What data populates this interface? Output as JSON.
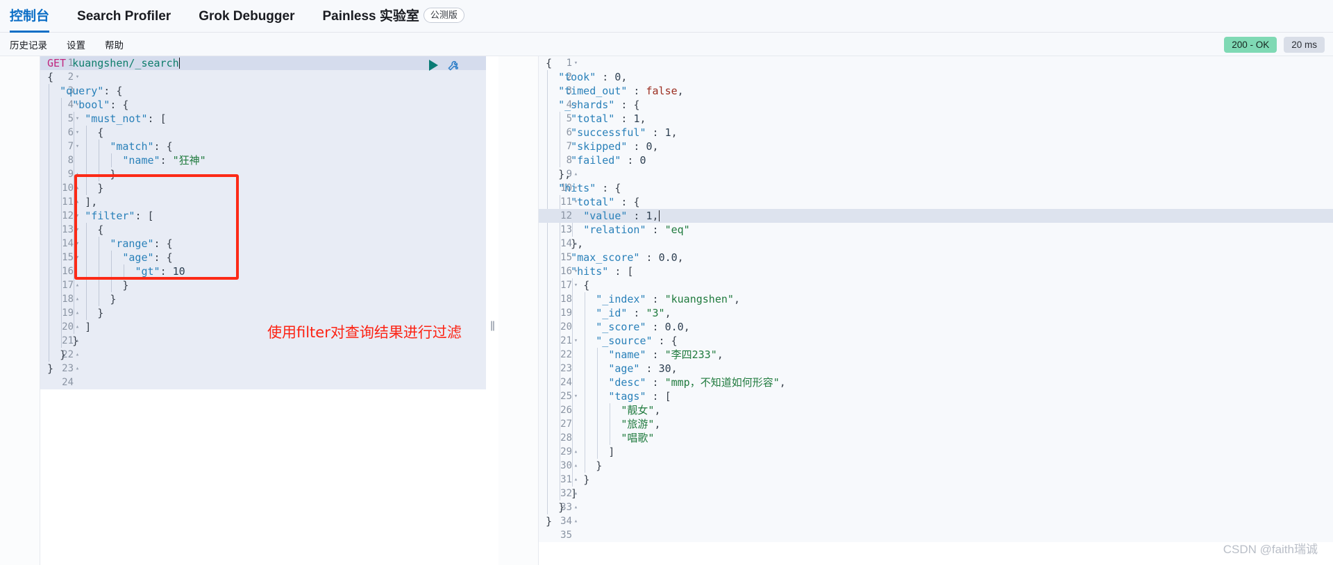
{
  "topnav": {
    "tabs": [
      {
        "label": "控制台",
        "active": true
      },
      {
        "label": "Search Profiler",
        "active": false
      },
      {
        "label": "Grok Debugger",
        "active": false
      },
      {
        "label": "Painless 实验室",
        "active": false,
        "badge": "公测版"
      }
    ]
  },
  "subbar": {
    "items": [
      {
        "label": "历史记录"
      },
      {
        "label": "设置"
      },
      {
        "label": "帮助"
      }
    ],
    "status": "200 - OK",
    "duration": "20 ms",
    "status_color": "#7fd9b4",
    "duration_color": "#d9dee8"
  },
  "icons": {
    "play": "play-icon",
    "wrench": "wrench-icon"
  },
  "request_editor": {
    "total_lines": 24,
    "lines": [
      {
        "n": 1,
        "fold": "",
        "indent": 0,
        "text": "GET kuangshen/_search",
        "type": "request",
        "method": "GET",
        "path": "kuangshen/_search",
        "caret": true,
        "highlight": true
      },
      {
        "n": 2,
        "fold": "▾",
        "indent": 0,
        "text": "{"
      },
      {
        "n": 3,
        "fold": "▾",
        "indent": 1,
        "text": "\"query\": {"
      },
      {
        "n": 4,
        "fold": "▾",
        "indent": 2,
        "text": "\"bool\": {"
      },
      {
        "n": 5,
        "fold": "▾",
        "indent": 3,
        "text": "\"must_not\": ["
      },
      {
        "n": 6,
        "fold": "▾",
        "indent": 4,
        "text": "{"
      },
      {
        "n": 7,
        "fold": "▾",
        "indent": 5,
        "text": "\"match\": {"
      },
      {
        "n": 8,
        "fold": "",
        "indent": 6,
        "text": "\"name\": \"狂神\""
      },
      {
        "n": 9,
        "fold": "▴",
        "indent": 5,
        "text": "}"
      },
      {
        "n": 10,
        "fold": "▴",
        "indent": 4,
        "text": "}"
      },
      {
        "n": 11,
        "fold": "▴",
        "indent": 3,
        "text": "],"
      },
      {
        "n": 12,
        "fold": "▾",
        "indent": 3,
        "text": "\"filter\": ["
      },
      {
        "n": 13,
        "fold": "▾",
        "indent": 4,
        "text": "{"
      },
      {
        "n": 14,
        "fold": "▾",
        "indent": 5,
        "text": "\"range\": {"
      },
      {
        "n": 15,
        "fold": "▾",
        "indent": 6,
        "text": "\"age\": {"
      },
      {
        "n": 16,
        "fold": "",
        "indent": 7,
        "text": "\"gt\": 10"
      },
      {
        "n": 17,
        "fold": "▴",
        "indent": 6,
        "text": "}"
      },
      {
        "n": 18,
        "fold": "▴",
        "indent": 5,
        "text": "}"
      },
      {
        "n": 19,
        "fold": "▴",
        "indent": 4,
        "text": "}"
      },
      {
        "n": 20,
        "fold": "▴",
        "indent": 3,
        "text": "]"
      },
      {
        "n": 21,
        "fold": "▴",
        "indent": 2,
        "text": "}"
      },
      {
        "n": 22,
        "fold": "▴",
        "indent": 1,
        "text": "}"
      },
      {
        "n": 23,
        "fold": "▴",
        "indent": 0,
        "text": "}"
      },
      {
        "n": 24,
        "fold": "",
        "indent": 0,
        "text": ""
      }
    ]
  },
  "response_editor": {
    "total_lines": 35,
    "highlighted_line": 12,
    "lines": [
      {
        "n": 1,
        "fold": "▾",
        "indent": 0,
        "text": "{"
      },
      {
        "n": 2,
        "fold": "",
        "indent": 1,
        "text": "\"took\" : 0,"
      },
      {
        "n": 3,
        "fold": "",
        "indent": 1,
        "text": "\"timed_out\" : false,"
      },
      {
        "n": 4,
        "fold": "▾",
        "indent": 1,
        "text": "\"_shards\" : {"
      },
      {
        "n": 5,
        "fold": "",
        "indent": 2,
        "text": "\"total\" : 1,"
      },
      {
        "n": 6,
        "fold": "",
        "indent": 2,
        "text": "\"successful\" : 1,"
      },
      {
        "n": 7,
        "fold": "",
        "indent": 2,
        "text": "\"skipped\" : 0,"
      },
      {
        "n": 8,
        "fold": "",
        "indent": 2,
        "text": "\"failed\" : 0"
      },
      {
        "n": 9,
        "fold": "▴",
        "indent": 1,
        "text": "},"
      },
      {
        "n": 10,
        "fold": "▾",
        "indent": 1,
        "text": "\"hits\" : {"
      },
      {
        "n": 11,
        "fold": "▾",
        "indent": 2,
        "text": "\"total\" : {"
      },
      {
        "n": 12,
        "fold": "",
        "indent": 3,
        "text": "\"value\" : 1,",
        "caret": true
      },
      {
        "n": 13,
        "fold": "",
        "indent": 3,
        "text": "\"relation\" : \"eq\""
      },
      {
        "n": 14,
        "fold": "▴",
        "indent": 2,
        "text": "},"
      },
      {
        "n": 15,
        "fold": "",
        "indent": 2,
        "text": "\"max_score\" : 0.0,"
      },
      {
        "n": 16,
        "fold": "▾",
        "indent": 2,
        "text": "\"hits\" : ["
      },
      {
        "n": 17,
        "fold": "▾",
        "indent": 3,
        "text": "{"
      },
      {
        "n": 18,
        "fold": "",
        "indent": 4,
        "text": "\"_index\" : \"kuangshen\","
      },
      {
        "n": 19,
        "fold": "",
        "indent": 4,
        "text": "\"_id\" : \"3\","
      },
      {
        "n": 20,
        "fold": "",
        "indent": 4,
        "text": "\"_score\" : 0.0,"
      },
      {
        "n": 21,
        "fold": "▾",
        "indent": 4,
        "text": "\"_source\" : {"
      },
      {
        "n": 22,
        "fold": "",
        "indent": 5,
        "text": "\"name\" : \"李四233\","
      },
      {
        "n": 23,
        "fold": "",
        "indent": 5,
        "text": "\"age\" : 30,"
      },
      {
        "n": 24,
        "fold": "",
        "indent": 5,
        "text": "\"desc\" : \"mmp，不知道如何形容\","
      },
      {
        "n": 25,
        "fold": "▾",
        "indent": 5,
        "text": "\"tags\" : ["
      },
      {
        "n": 26,
        "fold": "",
        "indent": 6,
        "text": "\"靓女\","
      },
      {
        "n": 27,
        "fold": "",
        "indent": 6,
        "text": "\"旅游\","
      },
      {
        "n": 28,
        "fold": "",
        "indent": 6,
        "text": "\"唱歌\""
      },
      {
        "n": 29,
        "fold": "▴",
        "indent": 5,
        "text": "]"
      },
      {
        "n": 30,
        "fold": "▴",
        "indent": 4,
        "text": "}"
      },
      {
        "n": 31,
        "fold": "▴",
        "indent": 3,
        "text": "}"
      },
      {
        "n": 32,
        "fold": "▴",
        "indent": 2,
        "text": "]"
      },
      {
        "n": 33,
        "fold": "▴",
        "indent": 1,
        "text": "}"
      },
      {
        "n": 34,
        "fold": "▴",
        "indent": 0,
        "text": "}"
      },
      {
        "n": 35,
        "fold": "",
        "indent": 0,
        "text": ""
      }
    ]
  },
  "annotation": {
    "text": "使用filter对查询结果进行过滤",
    "color": "#fc2314"
  },
  "watermark": {
    "text": "CSDN @faith瑞诚"
  }
}
